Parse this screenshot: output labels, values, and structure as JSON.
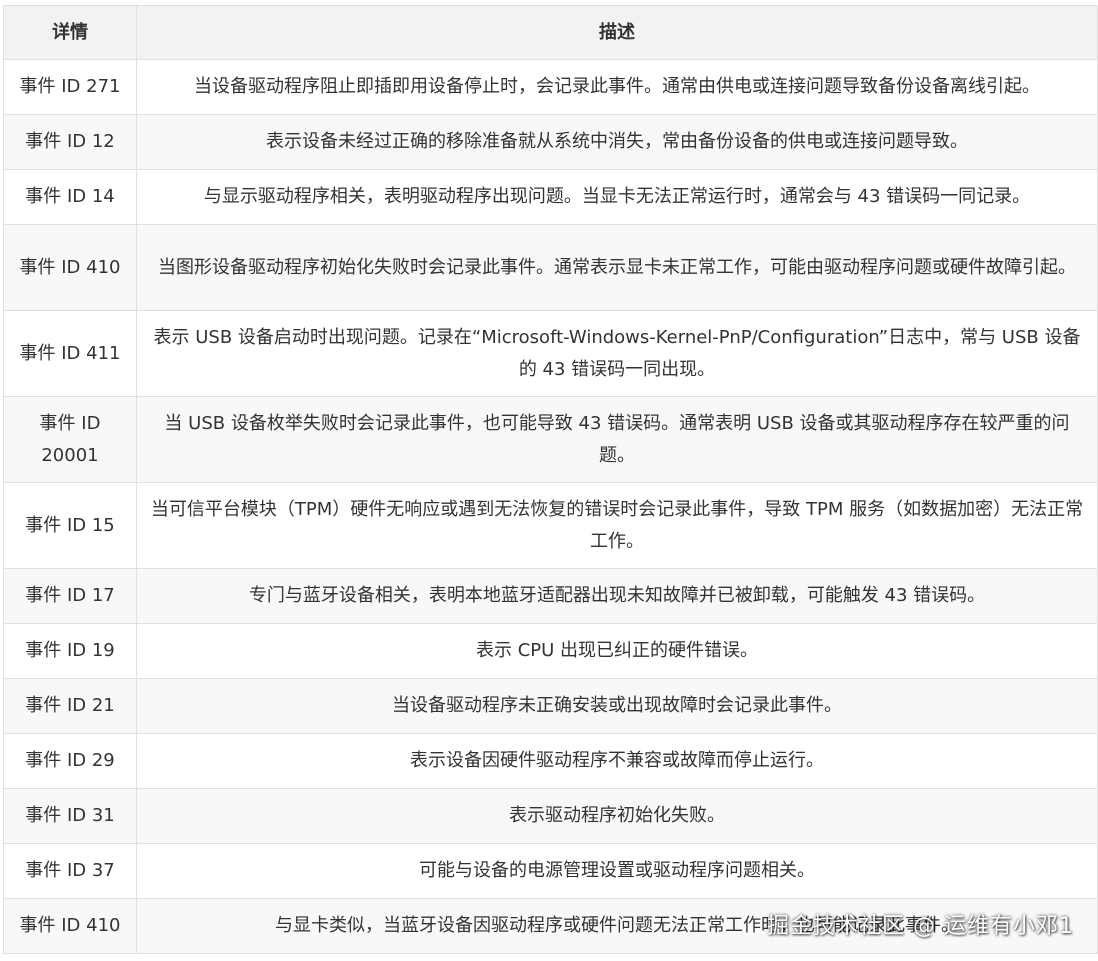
{
  "table": {
    "headers": {
      "detail": "详情",
      "description": "描述"
    },
    "rows": [
      {
        "detail": "事件 ID 271",
        "description": "当设备驱动程序阻止即插即用设备停止时，会记录此事件。通常由供电或连接问题导致备份设备离线引起。"
      },
      {
        "detail": "事件 ID 12",
        "description": "表示设备未经过正确的移除准备就从系统中消失，常由备份设备的供电或连接问题导致。"
      },
      {
        "detail": "事件 ID 14",
        "description": "与显示驱动程序相关，表明驱动程序出现问题。当显卡无法正常运行时，通常会与 43 错误码一同记录。"
      },
      {
        "detail": "事件 ID 410",
        "description": "当图形设备驱动程序初始化失败时会记录此事件。通常表示显卡未正常工作，可能由驱动程序问题或硬件故障引起。"
      },
      {
        "detail": "事件 ID 411",
        "description": "表示 USB 设备启动时出现问题。记录在“Microsoft-Windows-Kernel-PnP/Configuration”日志中，常与 USB 设备的 43 错误码一同出现。"
      },
      {
        "detail": "事件 ID 20001",
        "description": "当 USB 设备枚举失败时会记录此事件，也可能导致 43 错误码。通常表明 USB 设备或其驱动程序存在较严重的问题。"
      },
      {
        "detail": "事件 ID 15",
        "description": "当可信平台模块（TPM）硬件无响应或遇到无法恢复的错误时会记录此事件，导致 TPM 服务（如数据加密）无法正常工作。"
      },
      {
        "detail": "事件 ID 17",
        "description": "专门与蓝牙设备相关，表明本地蓝牙适配器出现未知故障并已被卸载，可能触发 43 错误码。"
      },
      {
        "detail": "事件 ID 19",
        "description": "表示 CPU 出现已纠正的硬件错误。"
      },
      {
        "detail": "事件 ID 21",
        "description": "当设备驱动程序未正确安装或出现故障时会记录此事件。"
      },
      {
        "detail": "事件 ID 29",
        "description": "表示设备因硬件驱动程序不兼容或故障而停止运行。"
      },
      {
        "detail": "事件 ID 31",
        "description": "表示驱动程序初始化失败。"
      },
      {
        "detail": "事件 ID 37",
        "description": "可能与设备的电源管理设置或驱动程序问题相关。"
      },
      {
        "detail": "事件 ID 410",
        "description": "与显卡类似，当蓝牙设备因驱动程序或硬件问题无法正常工作时，也可能记录此事件。"
      }
    ]
  },
  "watermark": "掘金技术社区 @ 运维有小邓1",
  "colors": {
    "header_bg": "#f2f2f2",
    "stripe_bg": "#f8f8f8",
    "border": "#e0e0e0",
    "text": "#333333"
  }
}
